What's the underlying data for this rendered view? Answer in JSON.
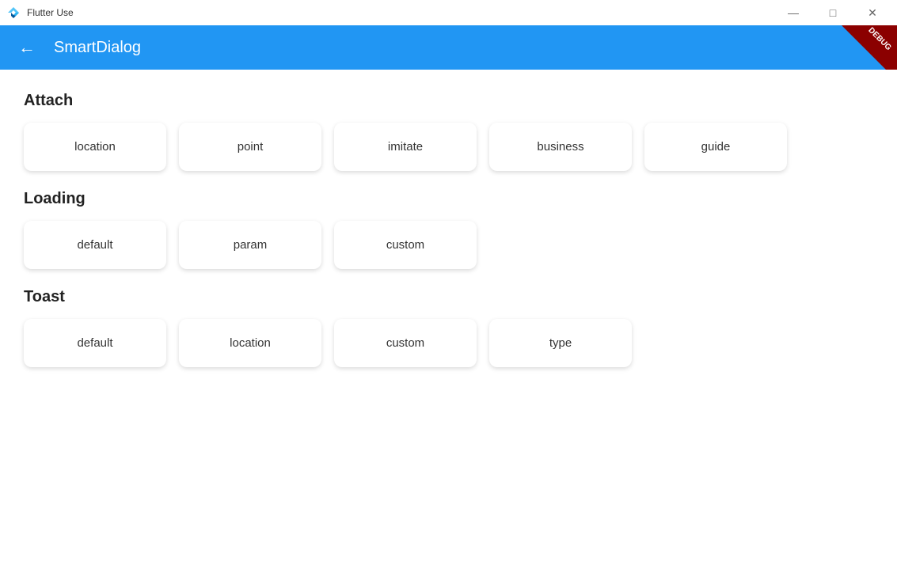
{
  "window": {
    "title": "Flutter Use",
    "controls": {
      "minimize": "—",
      "maximize": "□",
      "close": "✕"
    }
  },
  "appBar": {
    "title": "SmartDialog",
    "backIcon": "←",
    "debugLabel": "DEBUG"
  },
  "sections": [
    {
      "id": "attach",
      "title": "Attach",
      "buttons": [
        {
          "label": "location"
        },
        {
          "label": "point"
        },
        {
          "label": "imitate"
        },
        {
          "label": "business"
        },
        {
          "label": "guide"
        }
      ]
    },
    {
      "id": "loading",
      "title": "Loading",
      "buttons": [
        {
          "label": "default"
        },
        {
          "label": "param"
        },
        {
          "label": "custom"
        }
      ]
    },
    {
      "id": "toast",
      "title": "Toast",
      "buttons": [
        {
          "label": "default"
        },
        {
          "label": "location"
        },
        {
          "label": "custom"
        },
        {
          "label": "type"
        }
      ]
    }
  ]
}
